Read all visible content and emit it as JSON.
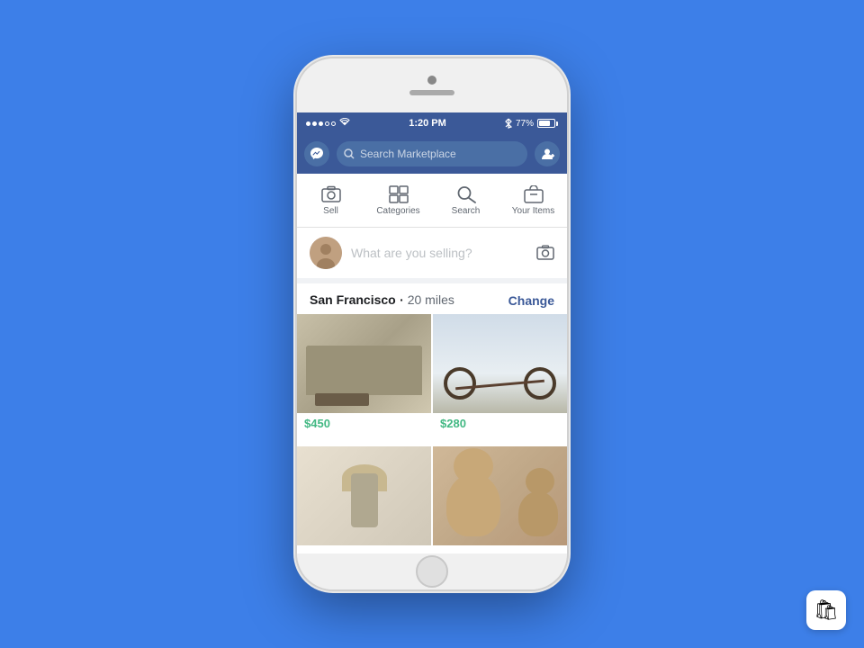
{
  "background": {
    "color": "#3d7fe8"
  },
  "status_bar": {
    "signal": "●●●○○",
    "wifi": "wifi",
    "time": "1:20 PM",
    "bluetooth": "bluetooth",
    "battery_pct": "77%"
  },
  "nav_bar": {
    "search_placeholder": "Search Marketplace",
    "messenger_icon": "messenger-icon",
    "profile_icon": "profile-icon"
  },
  "tab_bar": {
    "tabs": [
      {
        "id": "sell",
        "label": "Sell",
        "icon": "camera-icon"
      },
      {
        "id": "categories",
        "label": "Categories",
        "icon": "grid-icon"
      },
      {
        "id": "search",
        "label": "Search",
        "icon": "search-icon"
      },
      {
        "id": "your-items",
        "label": "Your Items",
        "icon": "bag-icon"
      }
    ]
  },
  "post_bar": {
    "placeholder": "What are you selling?"
  },
  "location": {
    "city": "San Francisco",
    "distance": "20 miles",
    "change_label": "Change"
  },
  "products": [
    {
      "id": "sofa",
      "price": "$450",
      "type": "sofa"
    },
    {
      "id": "bike",
      "price": "$280",
      "type": "bike"
    },
    {
      "id": "lamp",
      "price": "",
      "type": "lamp"
    },
    {
      "id": "bears",
      "price": "",
      "type": "bears"
    }
  ],
  "watermark": {
    "icon": "🛍"
  }
}
